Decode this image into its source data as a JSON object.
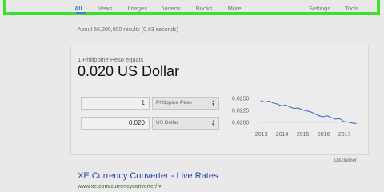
{
  "nav": {
    "tabs": [
      "All",
      "News",
      "Images",
      "Videos",
      "Books",
      "More"
    ],
    "right": [
      "Settings",
      "Tools"
    ]
  },
  "results_count": "About 56,200,000 results (0.83 seconds)",
  "converter": {
    "from_label": "1 Philippine Peso equals",
    "result": "0.020 US Dollar",
    "from_amount": "1",
    "from_currency": "Philippine Peso",
    "to_amount": "0.020",
    "to_currency": "US Dollar",
    "disclaimer": "Disclaimer"
  },
  "chart_data": {
    "type": "line",
    "x_ticks": [
      "2013",
      "2014",
      "2015",
      "2016",
      "2017"
    ],
    "y_ticks": [
      "0.0250",
      "0.0225",
      "0.0200"
    ],
    "ylim": [
      0.0192,
      0.0258
    ],
    "x": [
      2013.0,
      2013.2,
      2013.4,
      2013.6,
      2013.8,
      2014.0,
      2014.2,
      2014.4,
      2014.6,
      2014.8,
      2015.0,
      2015.2,
      2015.4,
      2015.6,
      2015.8,
      2016.0,
      2016.2,
      2016.4,
      2016.6,
      2016.8,
      2017.0,
      2017.2,
      2017.4,
      2017.6
    ],
    "y": [
      0.0245,
      0.0242,
      0.0244,
      0.024,
      0.0238,
      0.0234,
      0.0236,
      0.0232,
      0.0229,
      0.023,
      0.0226,
      0.0224,
      0.0222,
      0.0218,
      0.0214,
      0.0212,
      0.0214,
      0.021,
      0.0207,
      0.0208,
      0.0202,
      0.0201,
      0.0199,
      0.0198
    ],
    "color": "#3f6fcc"
  },
  "result": {
    "title": "XE Currency Converter - Live Rates",
    "url": "www.xe.com/currencyconverter/ ▾"
  },
  "colors": {
    "highlight": "#3ee02b",
    "link": "#2a45b8",
    "url": "#2f6b2f"
  }
}
